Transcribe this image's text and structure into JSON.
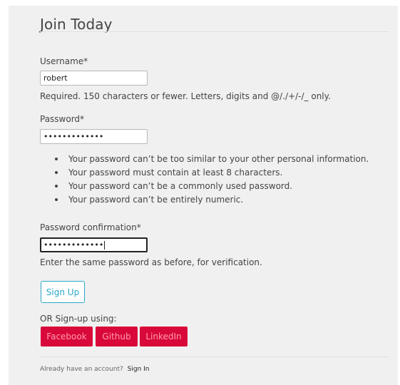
{
  "form": {
    "title": "Join Today",
    "username": {
      "label": "Username*",
      "value": "robert",
      "help": "Required. 150 characters or fewer. Letters, digits and @/./+/-/_ only."
    },
    "password": {
      "label": "Password*",
      "value": "•••••••••••••",
      "rules": [
        "Your password can’t be too similar to your other personal information.",
        "Your password must contain at least 8 characters.",
        "Your password can’t be a commonly used password.",
        "Your password can’t be entirely numeric."
      ]
    },
    "password_confirmation": {
      "label": "Password confirmation*",
      "value": "•••••••••••••",
      "help": "Enter the same password as before, for verification."
    },
    "submit_label": "Sign Up"
  },
  "social": {
    "label": "OR Sign-up using:",
    "buttons": [
      "Facebook",
      "Github",
      "LinkedIn"
    ]
  },
  "footer": {
    "text": "Already have an account?",
    "link": "Sign In"
  },
  "colors": {
    "panel_background": "#f0f0f0",
    "signup_accent": "#2aa9c8",
    "social_button": "#d9083a",
    "social_text": "#ff9bb1"
  }
}
